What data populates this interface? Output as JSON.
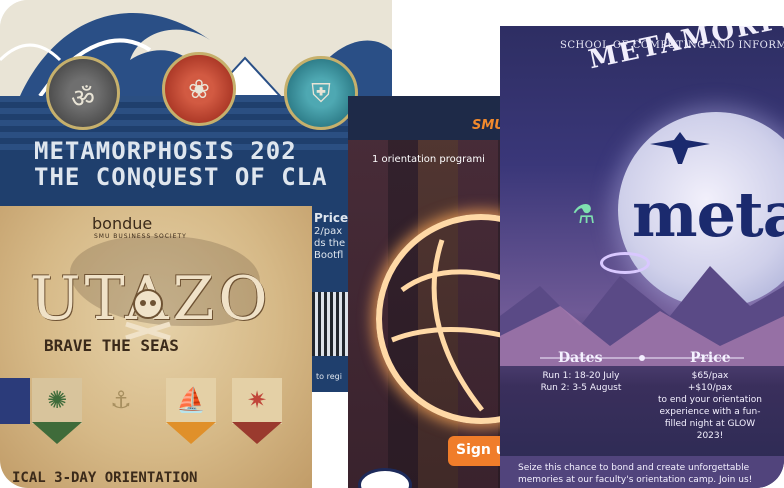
{
  "posters": {
    "conquest": {
      "title_line1": "METAMORPHOSIS 202",
      "title_line2": "THE CONQUEST OF CLA",
      "price_label": "Price",
      "price_value": "2/pax",
      "price_note_1": "ds the M",
      "price_note_2": "Bootfl",
      "register_note": "to regi",
      "icons": [
        "om-symbol-icon",
        "lotus-icon",
        "shield-icon"
      ],
      "colors": {
        "top": "#e9e4d6",
        "band": "#1f3f6d",
        "medal_gray": "#5e5e5e",
        "medal_red": "#c0463a",
        "medal_teal": "#3d95a0"
      }
    },
    "collage": {
      "logo": "SMU",
      "tagline": "1 orientation programi",
      "cta": "Sign u",
      "colors": {
        "cta": "#f07d2a",
        "glow": "#ffd9a6"
      }
    },
    "meta": {
      "school": "SCHOOL OF COMPUTING AND INFORMATI",
      "arc_title": "METAMORPHOSIS",
      "logo_word": "meta",
      "dates_header": "Dates",
      "dates_run1": "Run 1: 18-20 July",
      "dates_run2": "Run 2: 3-5 August",
      "price_header": "Price",
      "price_line1": "$65/pax",
      "price_line2": "+$10/pax",
      "price_line3": "to end your orientation",
      "price_line4": "experience with a fun-",
      "price_line5": "filled night at GLOW",
      "price_line6": "2023!",
      "footer_line1": "Seize this chance to bond and create unforgettable",
      "footer_line2": "memories at our faculty's orientation camp. Join us!",
      "colors": {
        "logo_word": "#1b2a6e",
        "sky_top": "#2e2e63",
        "sky_mid": "#6f5a96"
      }
    },
    "utazo": {
      "brand": "bondue",
      "brand_sub": "SMU BUSINESS SOCIETY",
      "title": "UTAZO",
      "subtitle": "BRAVE THE SEAS",
      "bottom_text": "ICAL 3-DAY ORIENTATION",
      "banners": [
        {
          "icon": "kraken-icon",
          "color": "#3f6b3a"
        },
        {
          "icon": "anchor-icon",
          "color": "#c9b58a"
        },
        {
          "icon": "ship-icon",
          "color": "#e0902a"
        },
        {
          "icon": "octopus-icon",
          "color": "#9a3a2e"
        }
      ]
    }
  }
}
